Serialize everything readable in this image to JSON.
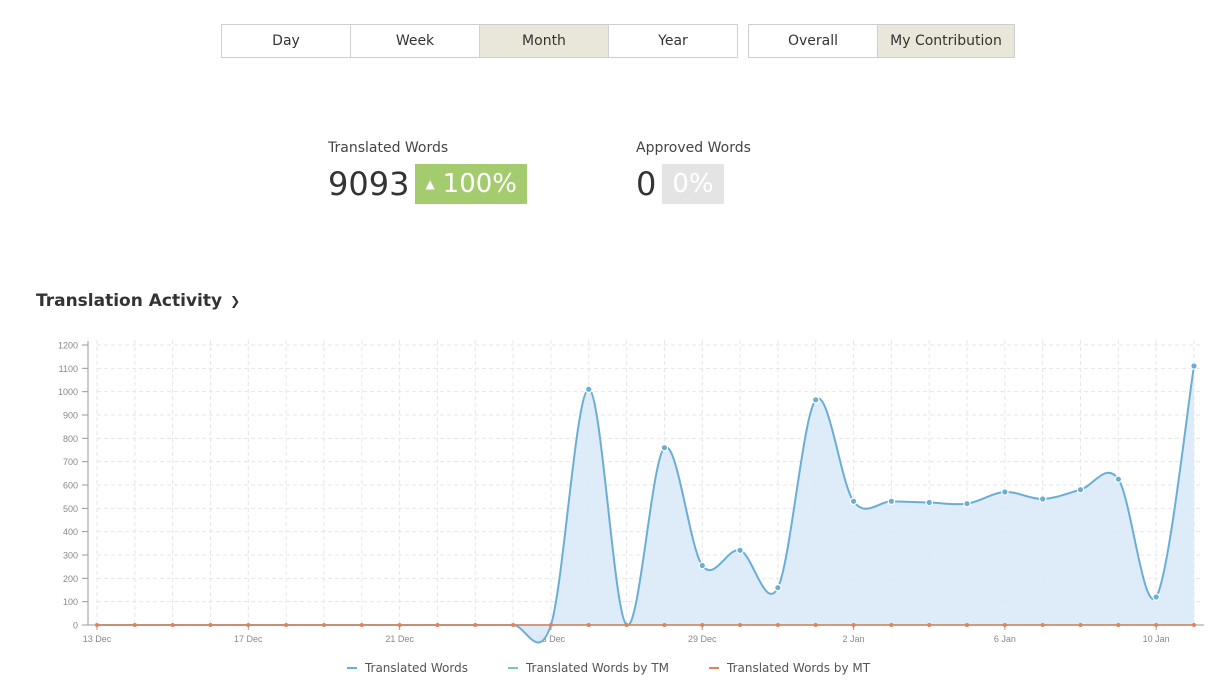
{
  "period_tabs": [
    {
      "label": "Day",
      "active": false
    },
    {
      "label": "Week",
      "active": false
    },
    {
      "label": "Month",
      "active": true
    },
    {
      "label": "Year",
      "active": false
    }
  ],
  "scope_tabs": [
    {
      "label": "Overall",
      "active": false
    },
    {
      "label": "My Contribution",
      "active": true
    }
  ],
  "stats": {
    "translated": {
      "label": "Translated Words",
      "value": "9093",
      "change": "100%",
      "color": "#a4cc6e"
    },
    "approved": {
      "label": "Approved Words",
      "value": "0",
      "change": "0%",
      "color": "#e4e4e4"
    }
  },
  "section": {
    "title": "Translation Activity"
  },
  "chart_data": {
    "type": "area",
    "yticks": [
      "0",
      "100",
      "200",
      "300",
      "400",
      "500",
      "600",
      "700",
      "800",
      "900",
      "1000",
      "1100",
      "1200"
    ],
    "ylim": [
      0,
      1200
    ],
    "xtick_labels": [
      {
        "day": 0,
        "label": "13 Dec"
      },
      {
        "day": 4,
        "label": "17 Dec"
      },
      {
        "day": 8,
        "label": "21 Dec"
      },
      {
        "day": 12,
        "label": "25 Dec"
      },
      {
        "day": 16,
        "label": "29 Dec"
      },
      {
        "day": 20,
        "label": "2 Jan"
      },
      {
        "day": 24,
        "label": "6 Jan"
      },
      {
        "day": 28,
        "label": "10 Jan"
      }
    ],
    "series": [
      {
        "name": "Translated Words",
        "color": "#6aaed6",
        "values": [
          0,
          0,
          0,
          0,
          0,
          0,
          0,
          0,
          0,
          0,
          0,
          0,
          0,
          1010,
          0,
          760,
          255,
          320,
          160,
          965,
          530,
          530,
          525,
          520,
          570,
          540,
          580,
          625,
          120,
          1110
        ]
      },
      {
        "name": "Translated Words by TM",
        "color": "#7fc2c2",
        "values": [
          0,
          0,
          0,
          0,
          0,
          0,
          0,
          0,
          0,
          0,
          0,
          0,
          0,
          0,
          0,
          0,
          0,
          0,
          0,
          0,
          0,
          0,
          0,
          0,
          0,
          0,
          0,
          0,
          0,
          0
        ]
      },
      {
        "name": "Translated Words by MT",
        "color": "#e0825a",
        "values": [
          0,
          0,
          0,
          0,
          0,
          0,
          0,
          0,
          0,
          0,
          0,
          0,
          0,
          0,
          0,
          0,
          0,
          0,
          0,
          0,
          0,
          0,
          0,
          0,
          0,
          0,
          0,
          0,
          0,
          0
        ]
      }
    ]
  }
}
